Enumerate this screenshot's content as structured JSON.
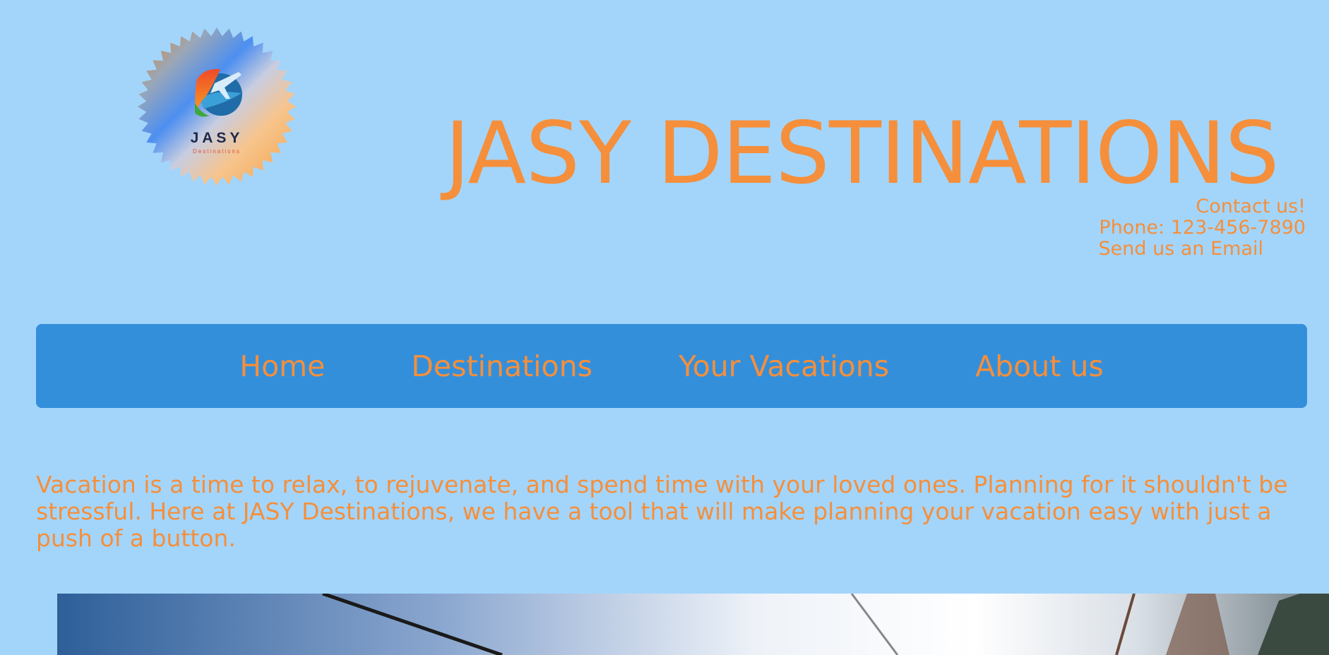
{
  "header": {
    "logo": {
      "icon": "travel-globe-plane-icon",
      "brand": "JASY",
      "tagline": "Destinations"
    },
    "title": "JASY DESTINATIONS",
    "contact": {
      "heading": "Contact us!",
      "phone": "Phone: 123-456-7890",
      "email_link": "Send us an Email"
    }
  },
  "nav": {
    "items": [
      {
        "label": "Home"
      },
      {
        "label": "Destinations"
      },
      {
        "label": "Your Vacations"
      },
      {
        "label": "About us"
      }
    ]
  },
  "main": {
    "intro": "Vacation is a time to relax, to rejuvenate, and spend time with your loved ones. Planning for it shouldn't be stressful. Here at JASY Destinations, we have a tool that will make planning your vacation easy with just a push of a button."
  },
  "colors": {
    "page_background": "#a3d5fb",
    "nav_background": "#348fdb",
    "accent_text": "#f58f3b",
    "logo_text": "#1c2a4a"
  }
}
